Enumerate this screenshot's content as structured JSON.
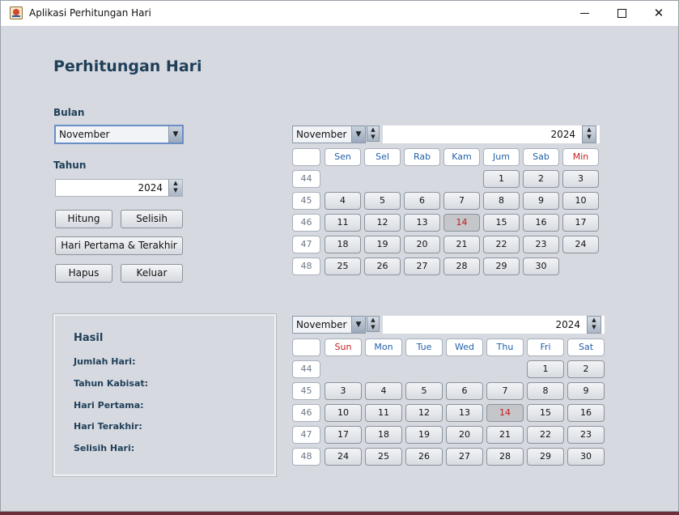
{
  "window": {
    "title": "Aplikasi Perhitungan Hari"
  },
  "main": {
    "heading": "Perhitungan Hari",
    "bulan_label": "Bulan",
    "bulan_value": "November",
    "tahun_label": "Tahun",
    "tahun_value": "2024",
    "buttons": {
      "hitung": "Hitung",
      "selisih": "Selisih",
      "pertama_terakhir": "Hari Pertama & Terakhir",
      "hapus": "Hapus",
      "keluar": "Keluar"
    }
  },
  "result": {
    "title": "Hasil",
    "jumlah": "Jumlah Hari:",
    "kabisat": "Tahun Kabisat:",
    "pertama": "Hari Pertama:",
    "terakhir": "Hari Terakhir:",
    "selisih": "Selisih Hari:"
  },
  "calendar1": {
    "month": "November",
    "year": "2024",
    "days": [
      "Sen",
      "Sel",
      "Rab",
      "Kam",
      "Jum",
      "Sab",
      "Min"
    ],
    "weeks": [
      "44",
      "45",
      "46",
      "47",
      "48"
    ],
    "rows": [
      [
        "",
        "",
        "",
        "",
        "1",
        "2",
        "3"
      ],
      [
        "4",
        "5",
        "6",
        "7",
        "8",
        "9",
        "10"
      ],
      [
        "11",
        "12",
        "13",
        "14",
        "15",
        "16",
        "17"
      ],
      [
        "18",
        "19",
        "20",
        "21",
        "22",
        "23",
        "24"
      ],
      [
        "25",
        "26",
        "27",
        "28",
        "29",
        "30",
        ""
      ]
    ]
  },
  "calendar2": {
    "month": "November",
    "year": "2024",
    "days": [
      "Sun",
      "Mon",
      "Tue",
      "Wed",
      "Thu",
      "Fri",
      "Sat"
    ],
    "weeks": [
      "44",
      "45",
      "46",
      "47",
      "48"
    ],
    "rows": [
      [
        "",
        "",
        "",
        "",
        "",
        "1",
        "2"
      ],
      [
        "3",
        "4",
        "5",
        "6",
        "7",
        "8",
        "9"
      ],
      [
        "10",
        "11",
        "12",
        "13",
        "14",
        "15",
        "16"
      ],
      [
        "17",
        "18",
        "19",
        "20",
        "21",
        "22",
        "23"
      ],
      [
        "24",
        "25",
        "26",
        "27",
        "28",
        "29",
        "30"
      ]
    ]
  },
  "colors": {
    "accent": "#1f3f58",
    "weekend": "#c41e1e",
    "header": "#2060a8"
  }
}
